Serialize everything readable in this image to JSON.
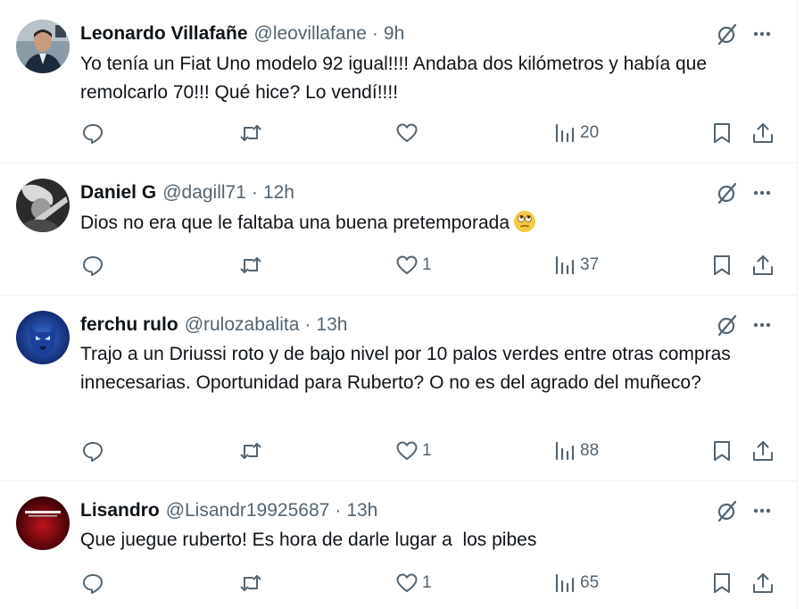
{
  "tweets": [
    {
      "name": "Leonardo Villafañe",
      "handle": "@leovillafane",
      "time": "9h",
      "text": "Yo tenía un Fiat Uno modelo 92 igual!!!! Andaba dos kilómetros y había que remolcarlo 70!!! Qué hice? Lo vendí!!!!",
      "replies": "",
      "reposts": "",
      "likes": "",
      "views": "20"
    },
    {
      "name": "Daniel G",
      "handle": "@dagill71",
      "time": "12h",
      "text": "Dios no era que le faltaba una buena pretemporada",
      "emoji": "face-with-rolling-eyes",
      "replies": "",
      "reposts": "",
      "likes": "1",
      "views": "37"
    },
    {
      "name": "ferchu rulo",
      "handle": "@rulozabalita",
      "time": "13h",
      "text": "Trajo a un Driussi roto y de bajo nivel por 10 palos verdes entre otras compras innecesarias. Oportunidad para Ruberto? O no es del agrado del muñeco?",
      "replies": "",
      "reposts": "",
      "likes": "1",
      "views": "88"
    },
    {
      "name": "Lisandro",
      "handle": "@Lisandr19925687",
      "time": "13h",
      "text": "Que juegue ruberto! Es hora de darle lugar a  los pibes",
      "replies": "",
      "reposts": "",
      "likes": "1",
      "views": "65"
    }
  ],
  "separator": "·",
  "icons": {
    "reply": "reply-icon",
    "repost": "repost-icon",
    "like": "heart-icon",
    "views": "views-chart-icon",
    "bookmark": "bookmark-icon",
    "share": "share-icon",
    "grok": "grok-icon",
    "more": "more-dots-icon"
  },
  "colors": {
    "text": "#0f1419",
    "secondary": "#536471",
    "divider": "#eff3f4"
  }
}
